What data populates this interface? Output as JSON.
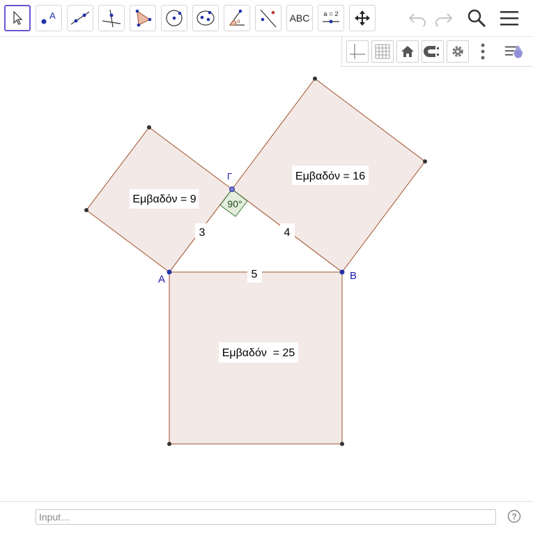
{
  "toolbar": {
    "text_tool_label": "ABC",
    "slider_tool_label": "a = 2"
  },
  "canvas": {
    "point_labels": {
      "A": "A",
      "B": "B",
      "G": "Γ"
    },
    "areas": {
      "small": "Εμβαδόν = 9",
      "medium": "Εμβαδόν = 16",
      "large": "Εμβαδόν  = 25"
    },
    "side_lengths": {
      "a": "3",
      "b": "4",
      "c": "5"
    },
    "angle": "90°",
    "colors": {
      "fill": "#f3e9e6",
      "edge": "#a0522d",
      "point": "#333333",
      "blue_point": "#2233aa",
      "label_blue": "#1a1aa6",
      "angle_fill": "#e3eedc",
      "angle_edge": "#3a7a3a"
    }
  },
  "input_bar": {
    "placeholder": "Input…"
  }
}
